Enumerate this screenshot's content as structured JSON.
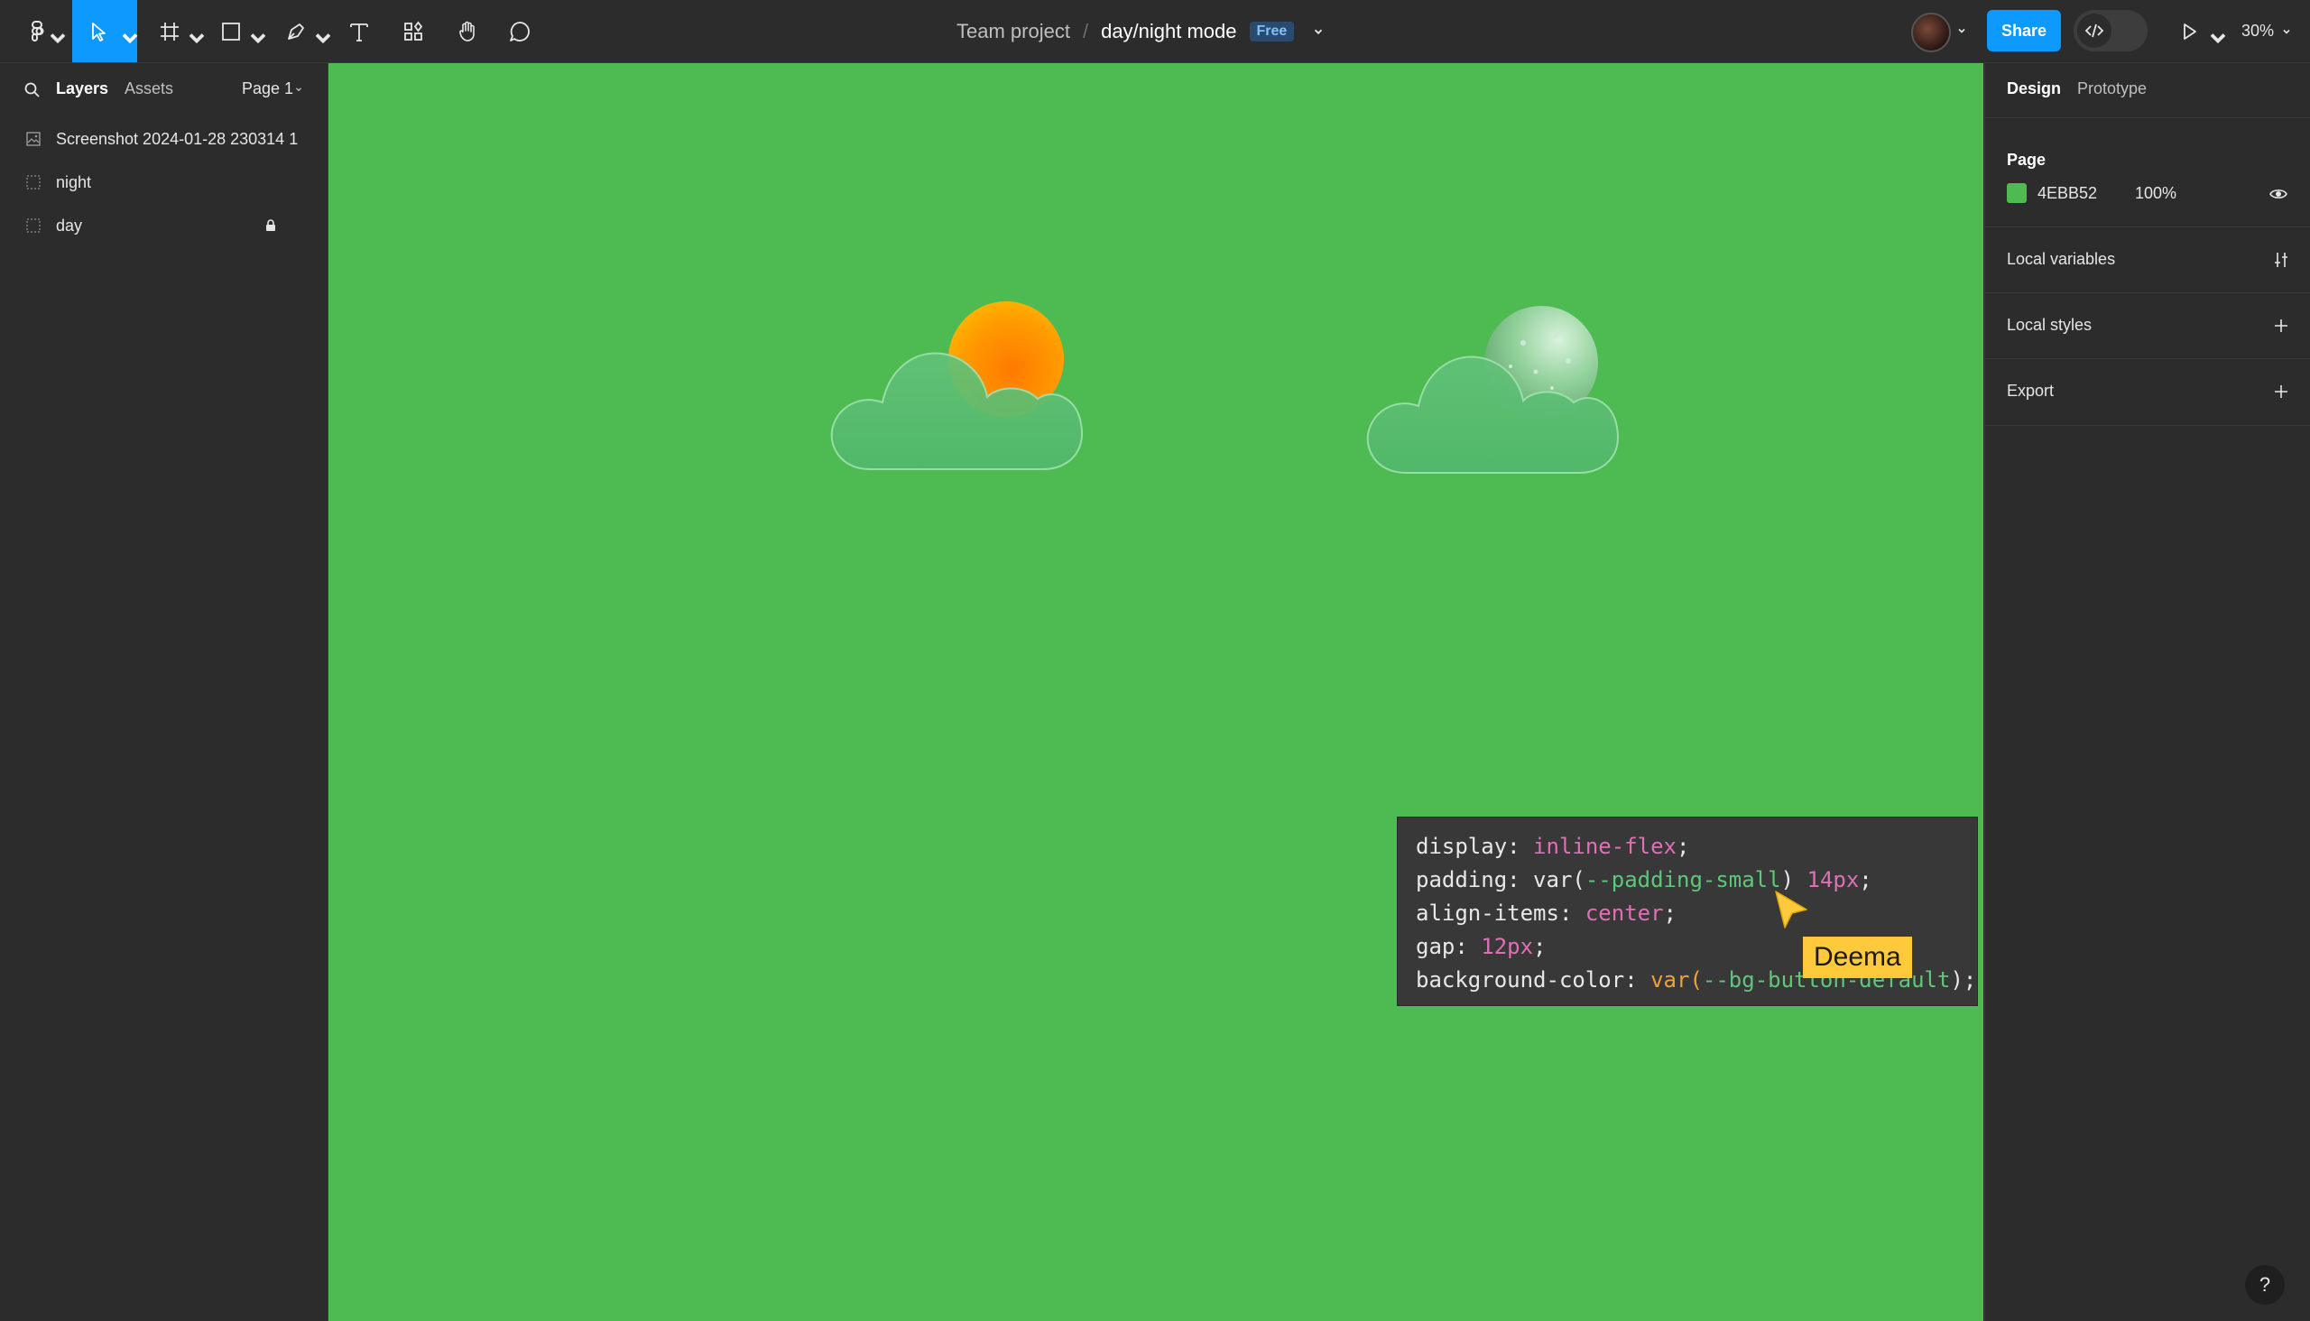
{
  "toolbar": {
    "breadcrumb_project": "Team project",
    "breadcrumb_separator": "/",
    "file_name": "day/night mode",
    "plan_badge": "Free",
    "share_label": "Share",
    "zoom_label": "30%",
    "accent_color": "#0d99ff",
    "tools": [
      "main-menu",
      "move",
      "frame",
      "shape",
      "pen",
      "text",
      "resources",
      "hand",
      "comment"
    ]
  },
  "left_panel": {
    "tabs": [
      "Layers",
      "Assets"
    ],
    "page_selector": "Page 1",
    "layers": [
      {
        "name": "Screenshot 2024-01-28 230314 1",
        "icon": "image-icon",
        "locked": false
      },
      {
        "name": "night",
        "icon": "frame-icon",
        "locked": false
      },
      {
        "name": "day",
        "icon": "frame-icon",
        "locked": true
      }
    ]
  },
  "canvas": {
    "background": "#4ebb52",
    "illustrations": [
      "sun-behind-cloud",
      "moon-behind-cloud"
    ],
    "code_lines": [
      [
        {
          "t": "display: ",
          "c": ""
        },
        {
          "t": "inline-flex",
          "c": "kw"
        },
        {
          "t": ";",
          "c": ""
        }
      ],
      [
        {
          "t": "padding: var(",
          "c": ""
        },
        {
          "t": "--padding-small",
          "c": "vr"
        },
        {
          "t": ") ",
          "c": ""
        },
        {
          "t": "14px",
          "c": "kw"
        },
        {
          "t": ";",
          "c": ""
        }
      ],
      [
        {
          "t": "align-items: ",
          "c": ""
        },
        {
          "t": "center",
          "c": "kw"
        },
        {
          "t": ";",
          "c": ""
        }
      ],
      [
        {
          "t": "gap: ",
          "c": ""
        },
        {
          "t": "12px",
          "c": "kw"
        },
        {
          "t": ";",
          "c": ""
        }
      ],
      [
        {
          "t": "background-color: ",
          "c": ""
        },
        {
          "t": "var(",
          "c": "fn"
        },
        {
          "t": "--bg-button-default",
          "c": "vr"
        },
        {
          "t": ");",
          "c": ""
        }
      ]
    ],
    "cursor_user": "Deema",
    "cursor_color": "#ffc93c"
  },
  "right_panel": {
    "tabs": [
      "Design",
      "Prototype"
    ],
    "page_heading": "Page",
    "page_color_hex": "4EBB52",
    "page_opacity": "100%",
    "sections": [
      "Local variables",
      "Local styles",
      "Export"
    ]
  },
  "help_label": "?"
}
